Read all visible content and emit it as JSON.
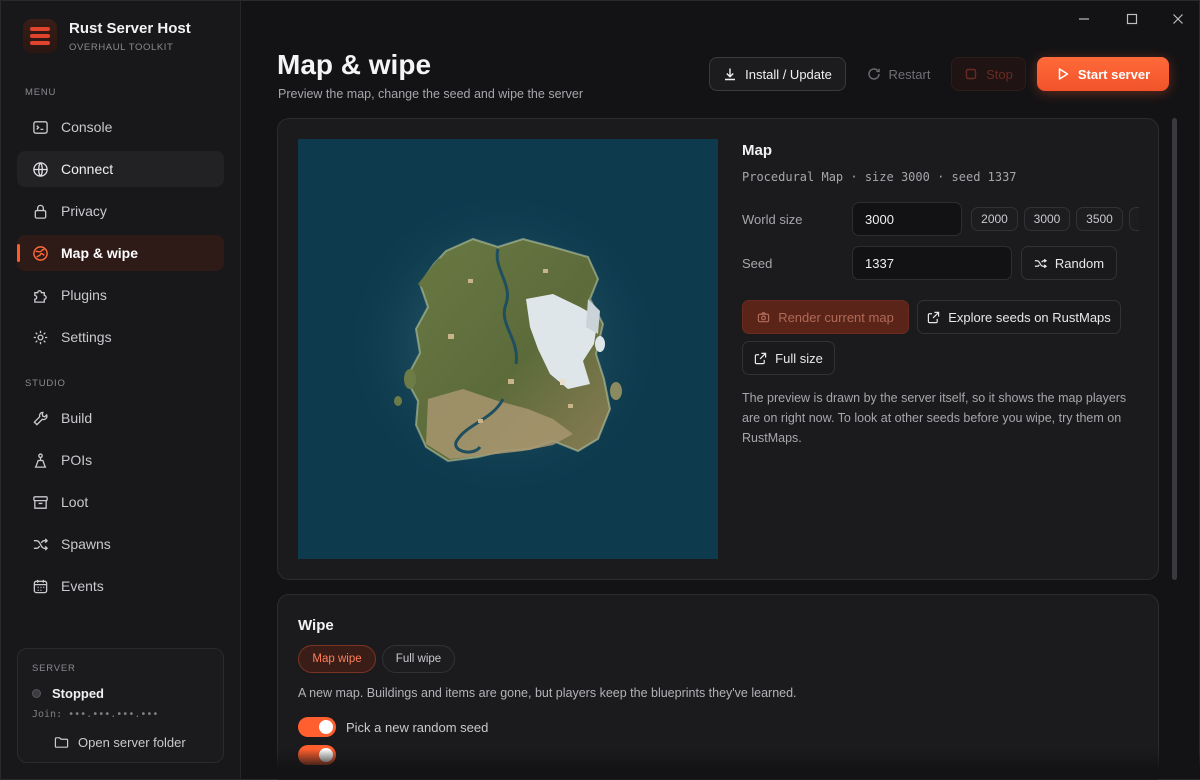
{
  "app": {
    "title": "Rust Server Host",
    "subtitle": "OVERHAUL TOOLKIT"
  },
  "sidebar": {
    "menu_label": "MENU",
    "studio_label": "STUDIO",
    "menu_items": [
      {
        "label": "Console",
        "icon": "console-icon"
      },
      {
        "label": "Connect",
        "icon": "globe-icon"
      },
      {
        "label": "Privacy",
        "icon": "lock-icon"
      },
      {
        "label": "Map & wipe",
        "icon": "map-icon",
        "active": true
      },
      {
        "label": "Plugins",
        "icon": "puzzle-icon"
      },
      {
        "label": "Settings",
        "icon": "gear-icon"
      }
    ],
    "studio_items": [
      {
        "label": "Build",
        "icon": "wrench-icon"
      },
      {
        "label": "POIs",
        "icon": "poi-icon"
      },
      {
        "label": "Loot",
        "icon": "archive-icon"
      },
      {
        "label": "Spawns",
        "icon": "shuffle-icon"
      },
      {
        "label": "Events",
        "icon": "calendar-icon"
      }
    ],
    "server": {
      "label": "SERVER",
      "status": "Stopped",
      "join": "Join: •••.•••.•••.•••",
      "folder_button": "Open server folder"
    }
  },
  "header": {
    "title": "Map & wipe",
    "subtitle": "Preview the map, change the seed and wipe the server",
    "install_label": "Install / Update",
    "restart_label": "Restart",
    "stop_label": "Stop",
    "start_label": "Start server"
  },
  "map": {
    "heading": "Map",
    "meta": "Procedural Map · size 3000 · seed 1337",
    "world_size_label": "World size",
    "world_size_value": "3000",
    "size_presets": [
      "2000",
      "3000",
      "3500"
    ],
    "seed_label": "Seed",
    "seed_value": "1337",
    "random_label": "Random",
    "render_label": "Render current map",
    "explore_label": "Explore seeds on RustMaps",
    "fullsize_label": "Full size",
    "note": "The preview is drawn by the server itself, so it shows the map players are on right now. To look at other seeds before you wipe, try them on RustMaps."
  },
  "wipe": {
    "heading": "Wipe",
    "map_wipe_label": "Map wipe",
    "full_wipe_label": "Full wipe",
    "description": "A new map. Buildings and items are gone, but players keep the blueprints they've learned.",
    "option_random_seed": "Pick a new random seed"
  },
  "colors": {
    "accent": "#ff5a2a",
    "ocean": "#0d3a4d"
  }
}
